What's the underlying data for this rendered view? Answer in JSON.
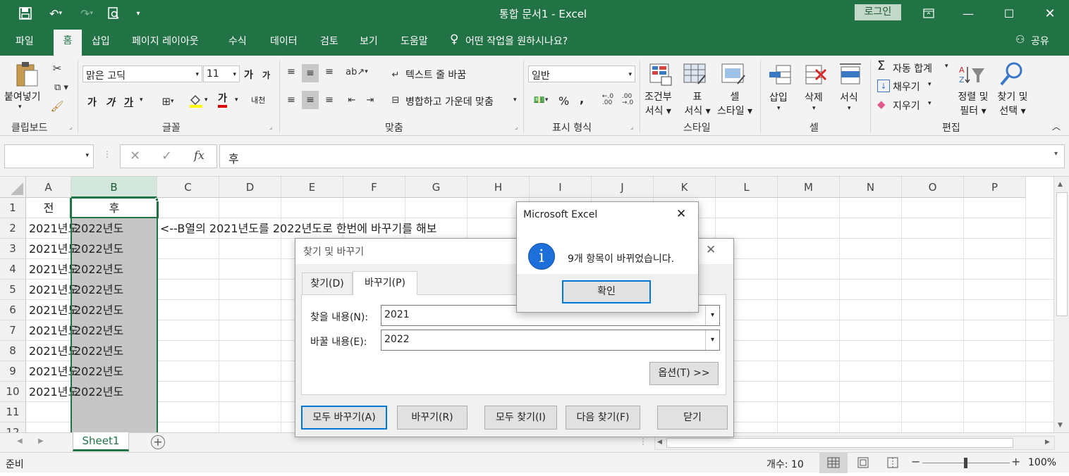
{
  "colors": {
    "brand": "#217346",
    "selected_fill": "#c6c6c6",
    "info_icon": "#1e6fd9"
  },
  "titlebar": {
    "title": "통합 문서1  -  Excel",
    "login_label": "로그인"
  },
  "tabs": [
    "파일",
    "홈",
    "삽입",
    "페이지 레이아웃",
    "수식",
    "데이터",
    "검토",
    "보기",
    "도움말"
  ],
  "tell_me": "어떤 작업을 원하시나요?",
  "share_label": "공유",
  "ribbon": {
    "clipboard": {
      "label": "클립보드",
      "paste": "붙여넣기"
    },
    "font": {
      "label": "글꼴",
      "font_name": "맑은 고딕",
      "font_size": "11",
      "bold": "가",
      "italic": "가",
      "underline": "가",
      "grow": "가",
      "shrink": "가",
      "font_color": "가",
      "phonetic": "내천"
    },
    "align": {
      "label": "맞춤",
      "wrap": "텍스트 줄 바꿈",
      "merge": "병합하고 가운데 맞춤"
    },
    "number": {
      "label": "표시 형식",
      "format": "일반",
      "percent": "%",
      "comma": ","
    },
    "styles": {
      "label": "스타일",
      "cond": [
        "조건부",
        "서식 ▾"
      ],
      "table": [
        "표",
        "서식 ▾"
      ],
      "cell": [
        "셀",
        "스타일 ▾"
      ]
    },
    "cells": {
      "label": "셀",
      "insert": "삽입",
      "delete": "삭제",
      "format": "서식"
    },
    "editing": {
      "label": "편집",
      "autosum": "자동 합계",
      "fill": "채우기",
      "clear": "지우기",
      "sort": [
        "정렬 및",
        "필터 ▾"
      ],
      "find": [
        "찾기 및",
        "선택 ▾"
      ]
    }
  },
  "formula_bar": {
    "name_box": "",
    "fx": "fx",
    "content": "후"
  },
  "columns": [
    "A",
    "B",
    "C",
    "D",
    "E",
    "F",
    "G",
    "H",
    "I",
    "J",
    "K",
    "L",
    "M",
    "N",
    "O",
    "P"
  ],
  "rows": [
    "1",
    "2",
    "3",
    "4",
    "5",
    "6",
    "7",
    "8",
    "9",
    "10",
    "11",
    "12"
  ],
  "cells": {
    "A": [
      "전",
      "2021년도",
      "2021년도",
      "2021년도",
      "2021년도",
      "2021년도",
      "2021년도",
      "2021년도",
      "2021년도",
      "2021년도"
    ],
    "B": [
      "후",
      "2022년도",
      "2022년도",
      "2022년도",
      "2022년도",
      "2022년도",
      "2022년도",
      "2022년도",
      "2022년도",
      "2022년도"
    ],
    "C2": "<--B열의 2021년도를 2022년도로 한번에 바꾸기를 해보"
  },
  "find_dialog": {
    "title": "찾기 및 바꾸기",
    "tab_find": "찾기(D)",
    "tab_replace": "바꾸기(P)",
    "find_label": "찾을 내용(N):",
    "find_value": "2021",
    "replace_label": "바꿀 내용(E):",
    "replace_value": "2022",
    "options": "옵션(T) >>",
    "replace_all": "모두 바꾸기(A)",
    "replace": "바꾸기(R)",
    "find_all": "모두 찾기(I)",
    "find_next": "다음 찾기(F)",
    "close": "닫기"
  },
  "message_box": {
    "title": "Microsoft Excel",
    "message": "9개 항목이 바뀌었습니다.",
    "ok": "확인",
    "icon": "i"
  },
  "sheet_tabs": [
    "Sheet1"
  ],
  "status": {
    "ready": "준비",
    "count": "개수: 10",
    "zoom": "100%"
  }
}
